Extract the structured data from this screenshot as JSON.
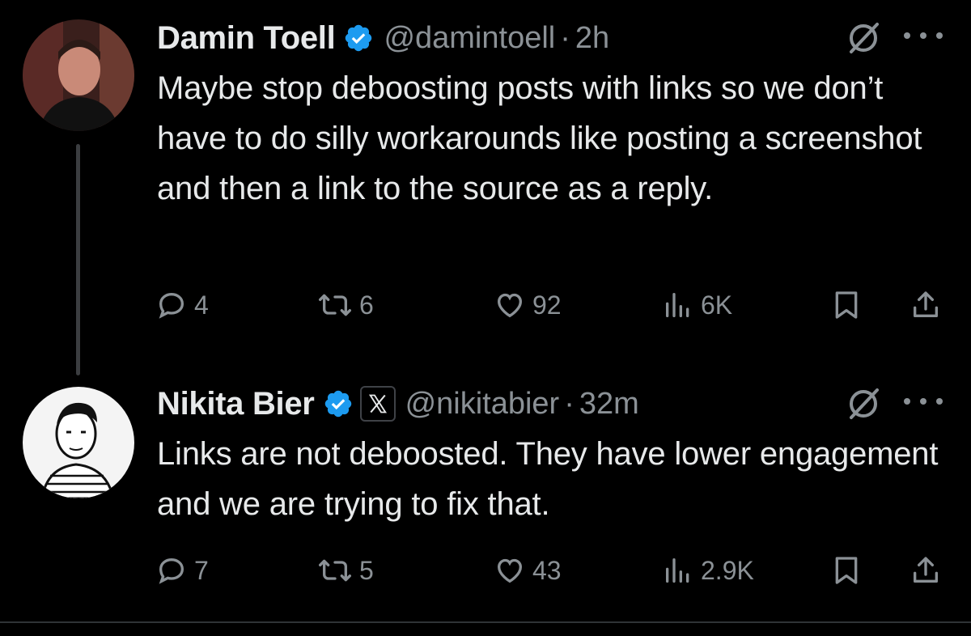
{
  "tweets": [
    {
      "author_name": "Damin Toell",
      "handle": "@damintoell",
      "separator": "·",
      "time": "2h",
      "text": "Maybe stop deboosting posts with links so we don’t have to do silly workarounds like posting a screenshot and then a link to the source as a reply.",
      "stats": {
        "replies": "4",
        "reposts": "6",
        "likes": "92",
        "views": "6K"
      }
    },
    {
      "author_name": "Nikita Bier",
      "handle": "@nikitabier",
      "separator": "·",
      "time": "32m",
      "affiliation_icon": "x-logo-icon",
      "text": "Links are not deboosted. They have lower engagement and we are trying to fix that.",
      "stats": {
        "replies": "7",
        "reposts": "5",
        "likes": "43",
        "views": "2.9K"
      }
    }
  ],
  "colors": {
    "background": "#000000",
    "primary_text": "#e7e9ea",
    "secondary_text": "#8b9196",
    "verified_badge": "#1d9bf0",
    "thread_line": "#3b3d40"
  },
  "icons": [
    "reply-icon",
    "repost-icon",
    "like-icon",
    "views-icon",
    "bookmark-icon",
    "share-icon",
    "grok-icon",
    "more-icon",
    "verified-badge-icon"
  ]
}
